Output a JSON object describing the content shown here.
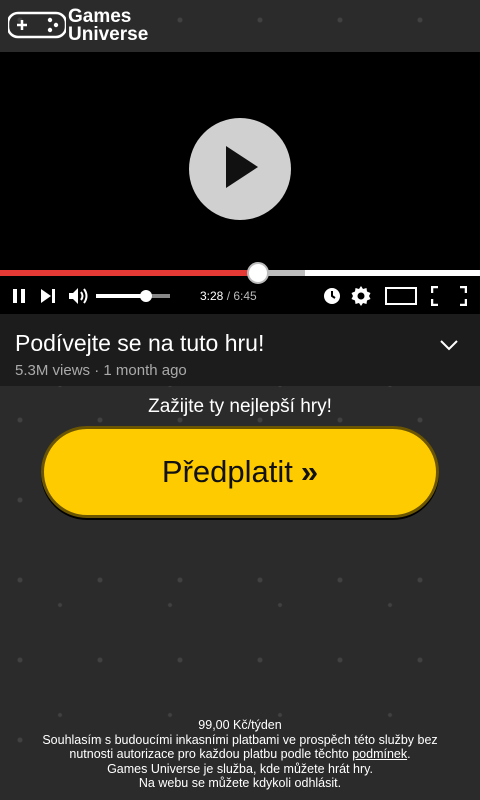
{
  "header": {
    "logo_line1": "Games",
    "logo_line2": "Universe"
  },
  "player": {
    "current_time": "3:28",
    "separator": " / ",
    "duration": "6:45",
    "progress_fraction": 0.537,
    "buffered_fraction": 0.635,
    "volume_fraction": 0.68
  },
  "video_info": {
    "title": "Podívejte se na tuto hru!",
    "views": "5.3M views",
    "dot": " · ",
    "age": "1 month ago"
  },
  "promo": {
    "tagline": "Zažijte ty nejlepší hry!",
    "cta_label": "Předplatit",
    "cta_arrow": "»"
  },
  "footer": {
    "price": "99,00 Kč/týden",
    "line2": "Souhlasím s budoucími inkasními platbami ve prospěch této služby bez",
    "line3_pre": "nutnosti autorizace pro každou platbu podle těchto ",
    "terms_link": "podmínek",
    "line3_post": ".",
    "line4": "Games Universe je služba, kde můžete hrát hry.",
    "line5": "Na webu se můžete kdykoli odhlásit."
  },
  "colors": {
    "accent": "#fecb00",
    "progress_played": "#e53935",
    "background": "#2b2b2b"
  }
}
